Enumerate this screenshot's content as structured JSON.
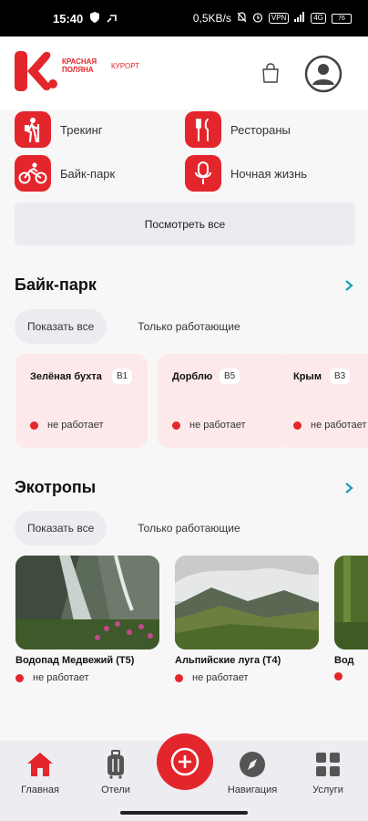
{
  "status_bar": {
    "time": "15:40",
    "speed": "0,5KB/s",
    "badge1": "VPN",
    "badge2": "4G",
    "battery": "76"
  },
  "header": {
    "logo_line1": "КРАСНАЯ",
    "logo_line2": "ПОЛЯНА",
    "logo_tag": "КУРОРТ",
    "bag_icon": "shopping-bag-icon",
    "avatar_icon": "user-avatar-icon"
  },
  "categories": [
    {
      "label": "Трекинг",
      "icon": "hiker-icon"
    },
    {
      "label": "Рестораны",
      "icon": "cutlery-icon"
    },
    {
      "label": "Байк-парк",
      "icon": "cyclist-icon"
    },
    {
      "label": "Ночная жизнь",
      "icon": "microphone-icon"
    }
  ],
  "see_all_label": "Посмотреть все",
  "bike_park": {
    "title": "Байк-парк",
    "filter_all": "Показать все",
    "filter_working": "Только работающие",
    "cards": [
      {
        "name": "Зелёная бухта",
        "code": "B1",
        "status": "не работает"
      },
      {
        "name": "Дорблю",
        "code": "B5",
        "status": "не работает"
      },
      {
        "name": "Крым",
        "code": "B3",
        "status": "не работает"
      }
    ]
  },
  "eco_trails": {
    "title": "Экотропы",
    "filter_all": "Показать все",
    "filter_working": "Только работающие",
    "cards": [
      {
        "name": "Водопад Медвежий (Т5)",
        "status": "не работает"
      },
      {
        "name": "Альпийские луга (Т4)",
        "status": "не работает"
      },
      {
        "name": "Вод",
        "status": ""
      }
    ]
  },
  "bottom_nav": {
    "items": [
      {
        "label": "Главная",
        "icon": "home-icon"
      },
      {
        "label": "Отели",
        "icon": "suitcase-icon"
      },
      {
        "label": "Навигация",
        "icon": "compass-icon"
      },
      {
        "label": "Услуги",
        "icon": "grid-icon"
      }
    ],
    "fab_icon": "plus-circle-icon"
  },
  "colors": {
    "accent": "#e3262c",
    "card_bg": "#fde9e9",
    "chip_bg": "#ebebf0",
    "chevron": "#18a0b5"
  }
}
